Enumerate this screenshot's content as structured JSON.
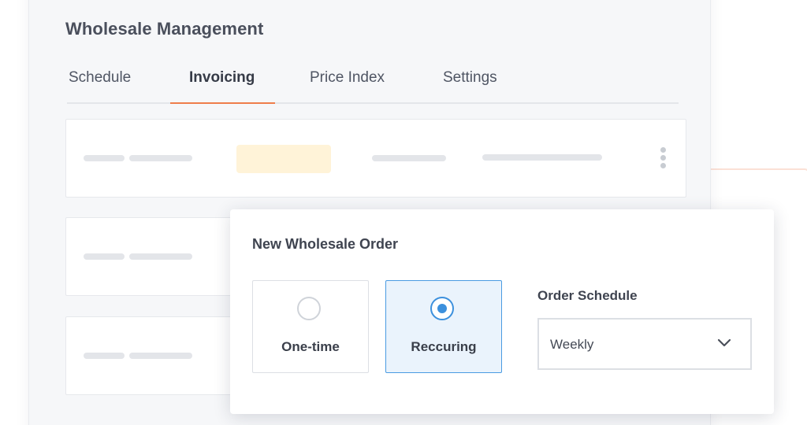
{
  "panel": {
    "title": "Wholesale Management"
  },
  "tabs": [
    {
      "label": "Schedule",
      "active": false
    },
    {
      "label": "Invoicing",
      "active": true
    },
    {
      "label": "Price Index",
      "active": false
    },
    {
      "label": "Settings",
      "active": false
    }
  ],
  "dialog": {
    "title": "New Wholesale Order",
    "options": [
      {
        "label": "One-time",
        "selected": false
      },
      {
        "label": "Reccuring",
        "selected": true
      }
    ],
    "schedule": {
      "label": "Order Schedule",
      "value": "Weekly"
    }
  },
  "icons": {
    "chevron": "chevron-down-icon",
    "kebab": "kebab-menu-icon",
    "radio_on": "radio-selected-icon",
    "radio_off": "radio-unselected-icon"
  },
  "colors": {
    "accent_orange": "#ef7d4a",
    "accent_blue": "#3c90dd",
    "selected_bg": "#eaf3fc",
    "pill_yellow": "#fff3d8"
  }
}
